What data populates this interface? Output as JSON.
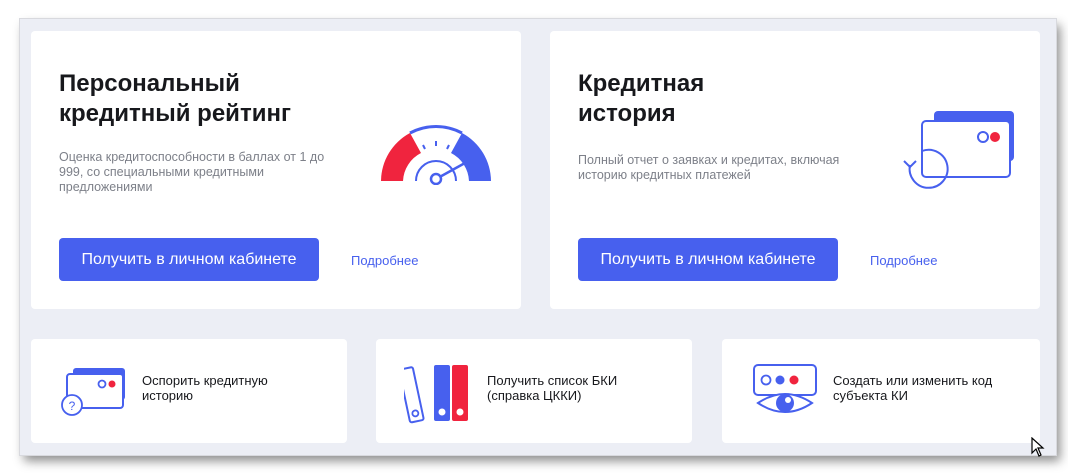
{
  "cards": [
    {
      "title_lines": [
        "Персональный",
        "кредитный рейтинг"
      ],
      "description": "Оценка кредитоспособности в баллах от 1 до 999, со специальными кредитными предложениями",
      "button_label": "Получить в личном кабинете",
      "link_label": "Подробнее",
      "icon": "gauge-icon"
    },
    {
      "title_lines": [
        "Кредитная",
        "история"
      ],
      "description": "Полный отчет о заявках и кредитах, включая историю кредитных платежей",
      "button_label": "Получить в личном кабинете",
      "link_label": "Подробнее",
      "icon": "credit-cards-icon"
    }
  ],
  "small_cards": [
    {
      "label": "Оспорить кредитную историю",
      "icon": "dispute-card-icon"
    },
    {
      "label": "Получить список БКИ (справка ЦККИ)",
      "icon": "binders-icon"
    },
    {
      "label": "Создать или изменить код субъекта КИ",
      "icon": "eye-code-icon"
    }
  ],
  "colors": {
    "accent": "#4760ee",
    "danger": "#f0243e",
    "title": "#17181c",
    "muted": "#7d8089",
    "background": "#eceef5"
  }
}
